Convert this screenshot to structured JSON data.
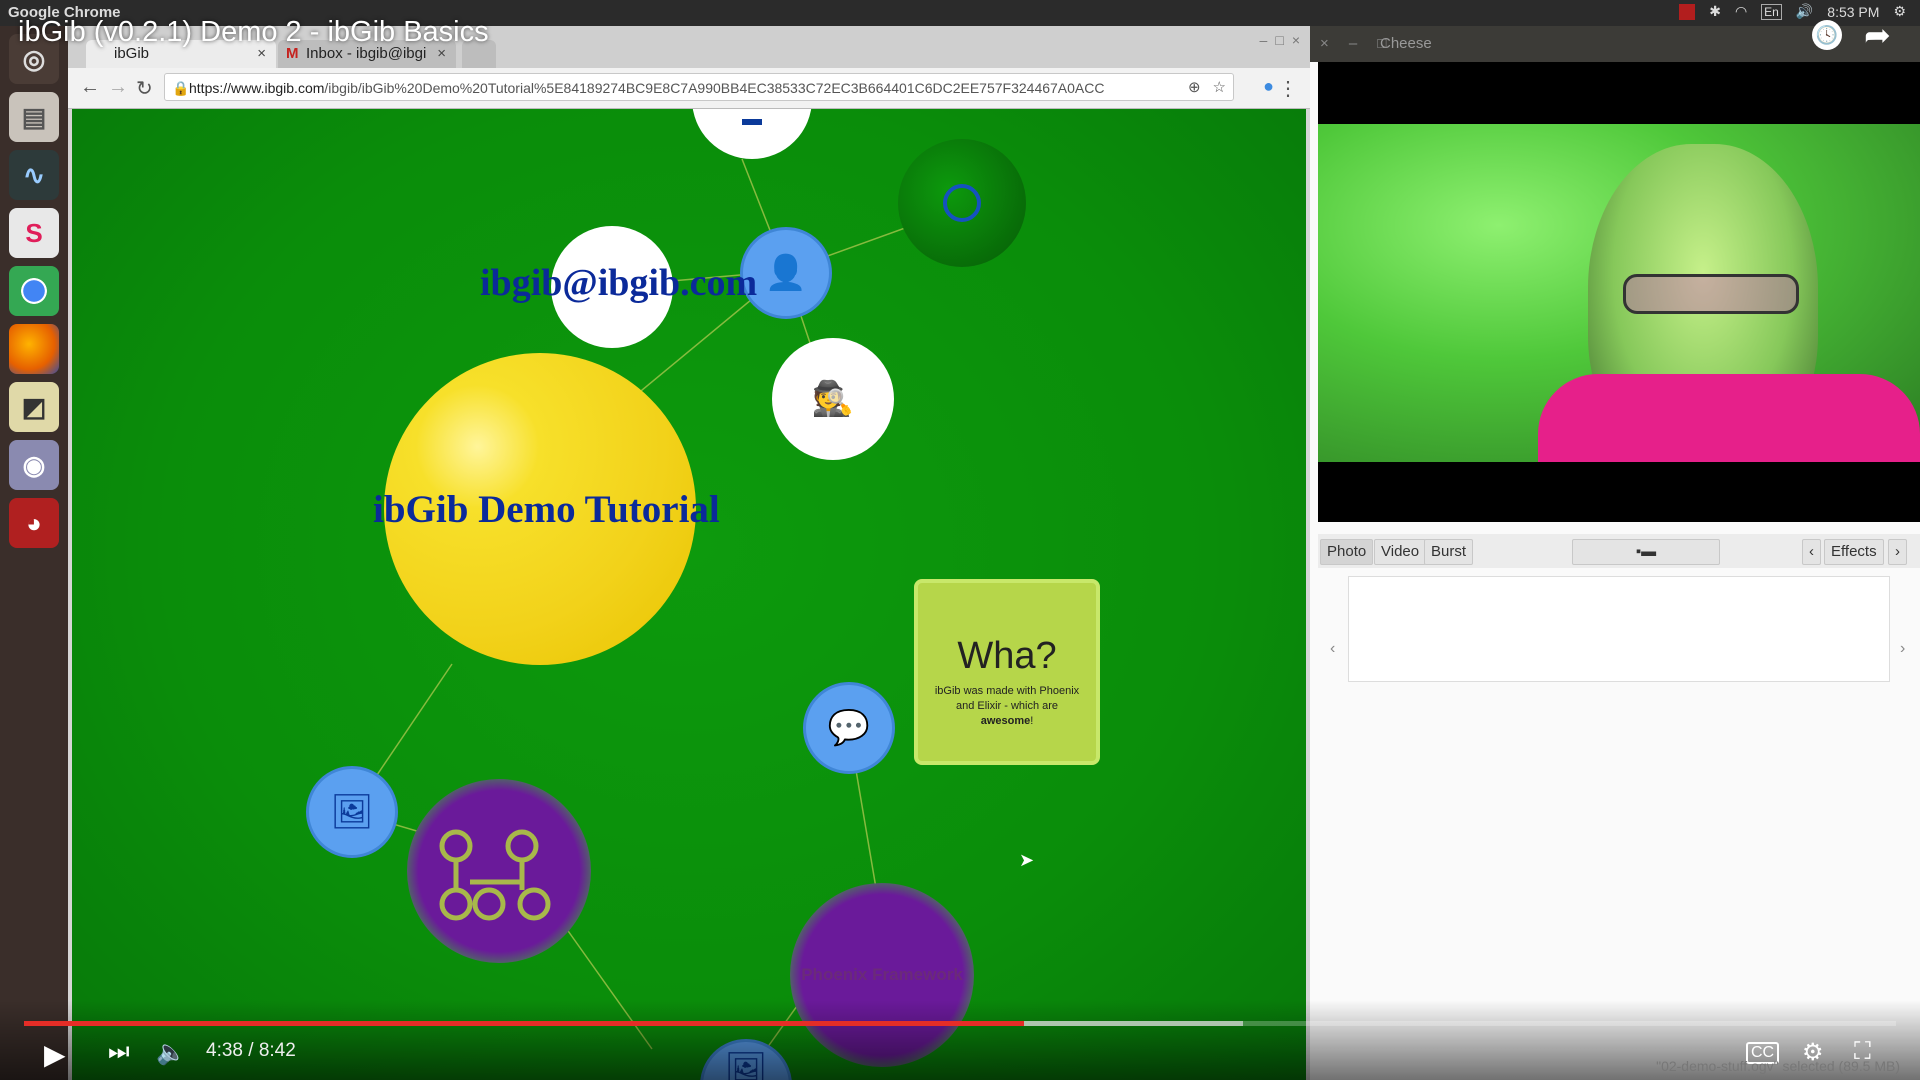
{
  "video": {
    "title": "ibGib (v0.2.1) Demo 2 - ibGib Basics",
    "time_current": "4:38",
    "time_total": "8:42",
    "time_sep": " / ",
    "progress_played": 0.534,
    "progress_loaded": 0.651,
    "accent": "#e52d27"
  },
  "desktop": {
    "app_name": "Google Chrome",
    "clock": "8:53 PM",
    "keyboard": "En",
    "launcher_icons": [
      "dash-icon",
      "files-icon",
      "system-monitor-icon",
      "slack-icon",
      "chrome-icon",
      "firefox-icon",
      "screenshot-icon",
      "cheese-webcam-icon",
      "app-icon"
    ]
  },
  "browser": {
    "tabs": [
      {
        "label": "ibGib"
      },
      {
        "label": "Inbox - ibgib@ibgi"
      }
    ],
    "url_host": "https://www.ibgib.com",
    "url_path": "/ibgib/ibGib%20Demo%20Tutorial%5E84189274BC9E8C7A990BB4EC38533C72EC3B664401C6DC2EE757F324467A0ACC"
  },
  "page": {
    "main_label": "ibGib Demo Tutorial",
    "email_label": "ibgib@ibgib.com",
    "card_title": "Wha?",
    "card_body_pre": "ibGib was made with Phoenix and Elixir - which are ",
    "card_body_bold": "awesome",
    "card_body_post": "!",
    "phoenix_label": "Phoenix Framework",
    "colors": {
      "background": "#0a8d0a",
      "node_blue": "#5ba0f0",
      "node_yellow": "#f2d21a",
      "node_purple": "#6a1a9a",
      "card": "#b6d64a",
      "label": "#0b2a9a"
    }
  },
  "cheese": {
    "window_title": "Cheese",
    "modes": [
      "Photo",
      "Video",
      "Burst"
    ],
    "effects_label": "Effects",
    "status": "\"02-demo-stuff.ogv\" selected (89.5 MB)"
  }
}
